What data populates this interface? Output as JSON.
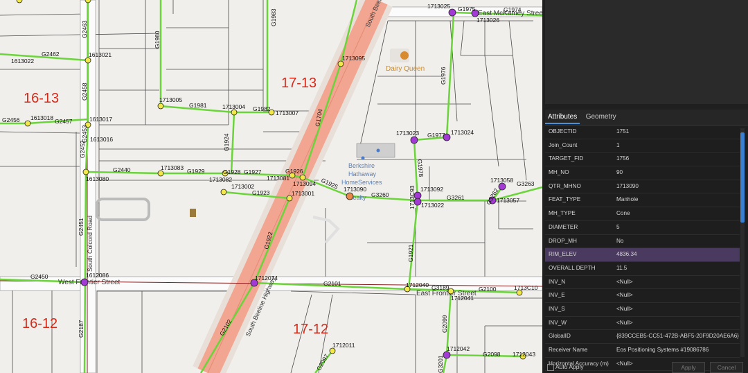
{
  "map": {
    "grid_labels": [
      "16-13",
      "17-13",
      "16-12",
      "17-12"
    ],
    "street_labels": [
      "South Beeline Highway",
      "South Beeline Highway",
      "South Colcord Road",
      "West Frontier Street",
      "East Frontier Street",
      "East McKamey Street"
    ],
    "poi": {
      "dairy_queen": "Dairy Queen",
      "berkshire": [
        "Berkshire",
        "Hathaway",
        "HomeServices",
        "Realty"
      ]
    },
    "manholes": [
      "1613021",
      "1613022",
      "1613018",
      "1613017",
      "1613016",
      "1613080",
      "1612086",
      "1713005",
      "1713004",
      "1713007",
      "1713083",
      "1713082",
      "1713081",
      "1713094",
      "1713002",
      "1713001",
      "1713090",
      "1713092",
      "1713022",
      "1713023",
      "1713024",
      "1713025",
      "1713026",
      "1713095",
      "1713058",
      "1713057",
      "1712074",
      "1712040",
      "1712041",
      "1712042",
      "1712011",
      "1712043",
      "1713C10"
    ],
    "lines": [
      "G2463",
      "G2462",
      "G2458",
      "G2456",
      "G2457",
      "G2452",
      "G2453",
      "G2440",
      "G1929",
      "G1928",
      "G1927",
      "G1926",
      "G2451",
      "G2450",
      "G2187",
      "G1980",
      "G1983",
      "G1981",
      "G1982",
      "G1924",
      "G1923",
      "G1922",
      "G2102",
      "G2101",
      "G1925",
      "G3260",
      "G1978",
      "G1976",
      "G1977",
      "G1975",
      "G1974",
      "G3261",
      "G3263",
      "G3262",
      "G1921",
      "G3189",
      "G2100",
      "G2099",
      "G2098",
      "G2097",
      "G1704",
      "G3201"
    ],
    "extra_labels": [
      "1713C93"
    ]
  },
  "panel": {
    "tabs": [
      "Attributes",
      "Geometry"
    ],
    "attributes": [
      {
        "key": "OBJECTID",
        "value": "1751"
      },
      {
        "key": "Join_Count",
        "value": "1"
      },
      {
        "key": "TARGET_FID",
        "value": "1756"
      },
      {
        "key": "MH_NO",
        "value": "90"
      },
      {
        "key": "QTR_MHNO",
        "value": "1713090"
      },
      {
        "key": "FEAT_TYPE",
        "value": "Manhole"
      },
      {
        "key": "MH_TYPE",
        "value": "Cone"
      },
      {
        "key": "DIAMETER",
        "value": "5"
      },
      {
        "key": "DROP_MH",
        "value": "No"
      },
      {
        "key": "RIM_ELEV",
        "value": "4836.34"
      },
      {
        "key": "OVERALL DEPTH",
        "value": "11.5"
      },
      {
        "key": "INV_N",
        "value": "<Null>"
      },
      {
        "key": "INV_E",
        "value": "<Null>"
      },
      {
        "key": "INV_S",
        "value": "<Null>"
      },
      {
        "key": "INV_W",
        "value": "<Null>"
      },
      {
        "key": "GlobalID",
        "value": "{839CCEB5-CC51-472B-ABF5-20F9D20AE6A6}"
      },
      {
        "key": "Receiver Name",
        "value": "Eos Positioning Systems #19086786"
      },
      {
        "key": "Horizontal Accuracy (m)",
        "value": "<Null>"
      }
    ],
    "selected_key": "RIM_ELEV",
    "auto_apply": "Auto Apply",
    "apply": "Apply",
    "cancel": "Cancel"
  },
  "colors": {
    "sewer": "#6ad43a",
    "highway": "#f0a08c",
    "grid_label": "#d42a1a",
    "selected_row": "#4b3a5f"
  }
}
